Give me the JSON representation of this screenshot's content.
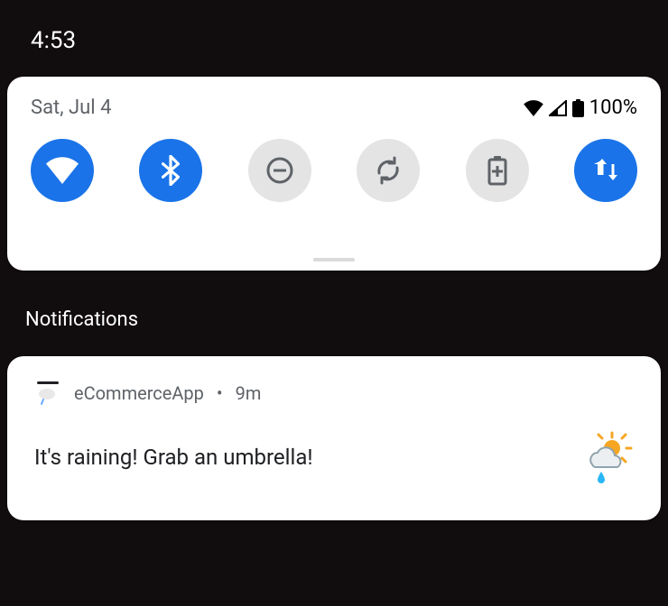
{
  "statusbar": {
    "time": "4:53"
  },
  "quick_settings": {
    "date": "Sat, Jul 4",
    "status": {
      "battery_pct": "100%"
    },
    "tiles": [
      {
        "icon": "wifi-icon",
        "active": true
      },
      {
        "icon": "bluetooth-icon",
        "active": true
      },
      {
        "icon": "do-not-disturb-icon",
        "active": false
      },
      {
        "icon": "auto-rotate-icon",
        "active": false
      },
      {
        "icon": "battery-saver-icon",
        "active": false
      },
      {
        "icon": "mobile-data-icon",
        "active": true
      }
    ]
  },
  "section_label": "Notifications",
  "notification": {
    "app_name": "eCommerceApp",
    "time": "9m",
    "separator": "•",
    "message": "It's raining! Grab an umbrella!",
    "large_icon": "weather-sun-rain-icon",
    "app_icon": "tag-cloud-icon"
  },
  "colors": {
    "tile_active": "#1a73e8",
    "tile_inactive": "#e4e4e4",
    "bg": "#110c0d"
  }
}
